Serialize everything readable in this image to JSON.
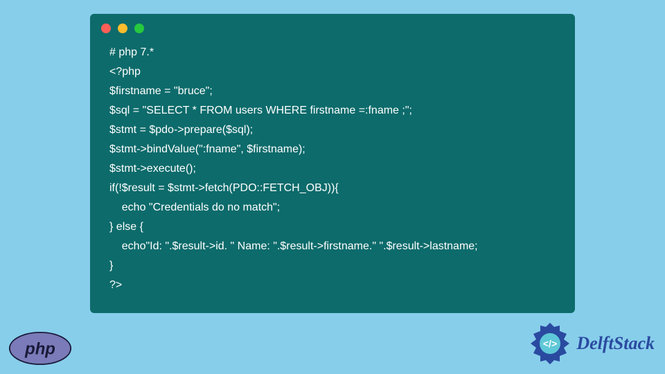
{
  "code": {
    "lines": [
      "# php 7.*",
      "<?php",
      "$firstname = \"bruce\";",
      "$sql = \"SELECT * FROM users WHERE firstname =:fname ;\";",
      "$stmt = $pdo->prepare($sql);",
      "$stmt->bindValue(\":fname\", $firstname);",
      "$stmt->execute();",
      "if(!$result = $stmt->fetch(PDO::FETCH_OBJ)){",
      "    echo \"Credentials do no match\";",
      "} else {",
      "    echo\"Id: \".$result->id. \" Name: \".$result->firstname.\" \".$result->lastname;",
      "}",
      "?>"
    ]
  },
  "logos": {
    "php_label": "php",
    "delftstack_label": "DelftStack"
  }
}
